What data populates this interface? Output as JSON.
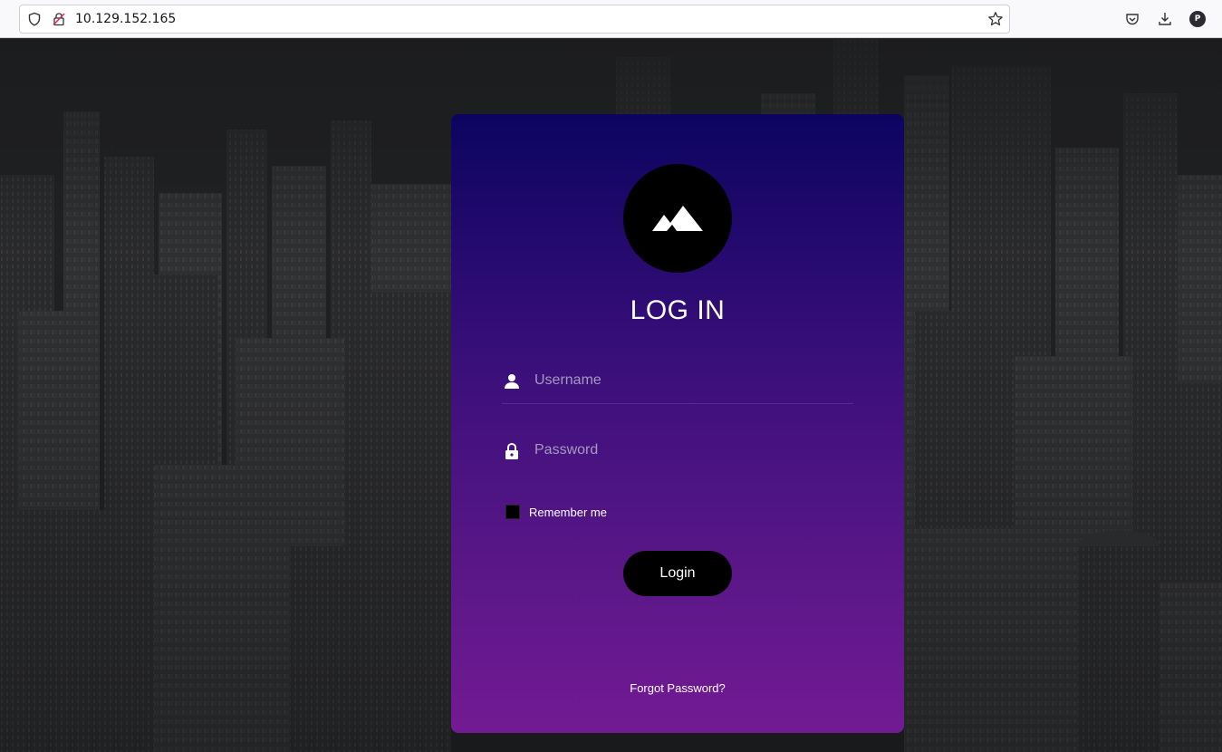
{
  "browser": {
    "url": "10.129.152.165",
    "account_initial": "P",
    "icons": [
      "shield-icon",
      "insecure-lock-icon",
      "bookmark-star-icon",
      "pocket-icon",
      "download-icon",
      "account-icon"
    ]
  },
  "login": {
    "title": "LOG IN",
    "username_placeholder": "Username",
    "password_placeholder": "Password",
    "remember_label": "Remember me",
    "login_label": "Login",
    "forgot_label": "Forgot Password?"
  },
  "colors": {
    "card_top": "#0c0460",
    "card_bottom": "#731a93",
    "button": "#000000"
  }
}
